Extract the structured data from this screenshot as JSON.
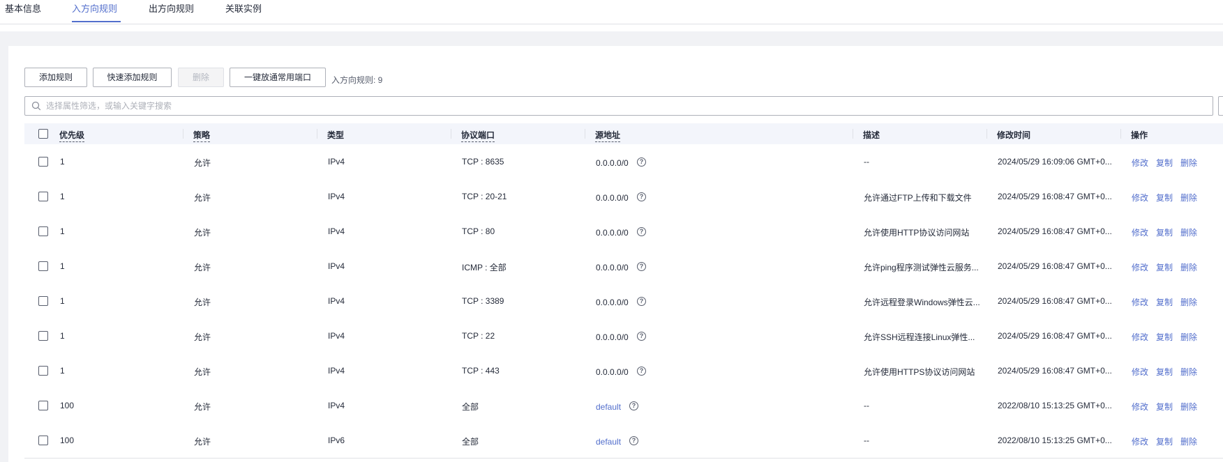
{
  "tabs": [
    {
      "label": "基本信息"
    },
    {
      "label": "入方向规则",
      "active": true
    },
    {
      "label": "出方向规则"
    },
    {
      "label": "关联实例"
    }
  ],
  "toolbar": {
    "add_rule": "添加规则",
    "quick_add_rule": "快速添加规则",
    "delete": "删除",
    "open_common_ports": "一键放通常用端口",
    "rule_count_label": "入方向规则: 9"
  },
  "search": {
    "placeholder": "选择属性筛选，或输入关键字搜索",
    "value": "",
    "icon": "search-icon"
  },
  "table": {
    "columns": {
      "priority": "优先级",
      "policy": "策略",
      "type": "类型",
      "protocol_port": "协议端口",
      "source": "源地址",
      "description": "描述",
      "modified_time": "修改时间",
      "actions": "操作"
    },
    "action_labels": {
      "edit": "修改",
      "copy": "复制",
      "delete": "删除"
    },
    "rows": [
      {
        "priority": "1",
        "policy": "允许",
        "type": "IPv4",
        "protocol_port": "TCP : 8635",
        "source": "0.0.0.0/0",
        "source_link": false,
        "description": "--",
        "modified_time": "2024/05/29 16:09:06 GMT+0..."
      },
      {
        "priority": "1",
        "policy": "允许",
        "type": "IPv4",
        "protocol_port": "TCP : 20-21",
        "source": "0.0.0.0/0",
        "source_link": false,
        "description": "允许通过FTP上传和下载文件",
        "modified_time": "2024/05/29 16:08:47 GMT+0..."
      },
      {
        "priority": "1",
        "policy": "允许",
        "type": "IPv4",
        "protocol_port": "TCP : 80",
        "source": "0.0.0.0/0",
        "source_link": false,
        "description": "允许使用HTTP协议访问网站",
        "modified_time": "2024/05/29 16:08:47 GMT+0..."
      },
      {
        "priority": "1",
        "policy": "允许",
        "type": "IPv4",
        "protocol_port": "ICMP : 全部",
        "source": "0.0.0.0/0",
        "source_link": false,
        "description": "允许ping程序测试弹性云服务...",
        "modified_time": "2024/05/29 16:08:47 GMT+0..."
      },
      {
        "priority": "1",
        "policy": "允许",
        "type": "IPv4",
        "protocol_port": "TCP : 3389",
        "source": "0.0.0.0/0",
        "source_link": false,
        "description": "允许远程登录Windows弹性云...",
        "modified_time": "2024/05/29 16:08:47 GMT+0..."
      },
      {
        "priority": "1",
        "policy": "允许",
        "type": "IPv4",
        "protocol_port": "TCP : 22",
        "source": "0.0.0.0/0",
        "source_link": false,
        "description": "允许SSH远程连接Linux弹性...",
        "modified_time": "2024/05/29 16:08:47 GMT+0..."
      },
      {
        "priority": "1",
        "policy": "允许",
        "type": "IPv4",
        "protocol_port": "TCP : 443",
        "source": "0.0.0.0/0",
        "source_link": false,
        "description": "允许使用HTTPS协议访问网站",
        "modified_time": "2024/05/29 16:08:47 GMT+0..."
      },
      {
        "priority": "100",
        "policy": "允许",
        "type": "IPv4",
        "protocol_port": "全部",
        "source": "default",
        "source_link": true,
        "description": "--",
        "modified_time": "2022/08/10 15:13:25 GMT+0..."
      },
      {
        "priority": "100",
        "policy": "允许",
        "type": "IPv6",
        "protocol_port": "全部",
        "source": "default",
        "source_link": true,
        "description": "--",
        "modified_time": "2022/08/10 15:13:25 GMT+0..."
      }
    ]
  },
  "colors": {
    "accent": "#526ecc",
    "header_bg": "#f3f5fb",
    "page_gray": "#f1f2f5",
    "border": "#dfe1e6"
  }
}
